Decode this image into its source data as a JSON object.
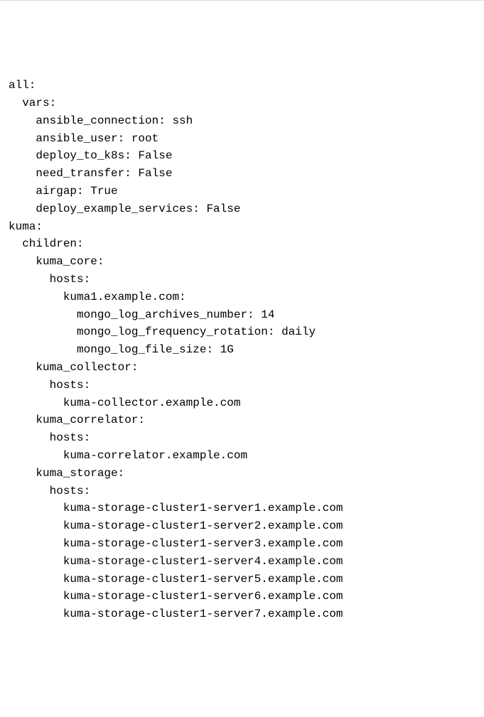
{
  "lines": [
    {
      "indent": 0,
      "text": "all:"
    },
    {
      "indent": 1,
      "text": "vars:"
    },
    {
      "indent": 2,
      "text": "ansible_connection: ssh"
    },
    {
      "indent": 2,
      "text": "ansible_user: root"
    },
    {
      "indent": 2,
      "text": "deploy_to_k8s: False"
    },
    {
      "indent": 2,
      "text": "need_transfer: False"
    },
    {
      "indent": 2,
      "text": "airgap: True"
    },
    {
      "indent": 2,
      "text": "deploy_example_services: False"
    },
    {
      "indent": 0,
      "text": "kuma:"
    },
    {
      "indent": 1,
      "text": "children:"
    },
    {
      "indent": 2,
      "text": "kuma_core:"
    },
    {
      "indent": 3,
      "text": "hosts:"
    },
    {
      "indent": 4,
      "text": "kuma1.example.com:"
    },
    {
      "indent": 5,
      "text": "mongo_log_archives_number: 14"
    },
    {
      "indent": 5,
      "text": "mongo_log_frequency_rotation: daily"
    },
    {
      "indent": 5,
      "text": "mongo_log_file_size: 1G"
    },
    {
      "indent": 2,
      "text": "kuma_collector:"
    },
    {
      "indent": 3,
      "text": "hosts:"
    },
    {
      "indent": 4,
      "text": "kuma-collector.example.com"
    },
    {
      "indent": 2,
      "text": "kuma_correlator:"
    },
    {
      "indent": 3,
      "text": "hosts:"
    },
    {
      "indent": 4,
      "text": "kuma-correlator.example.com"
    },
    {
      "indent": 2,
      "text": "kuma_storage:"
    },
    {
      "indent": 3,
      "text": "hosts:"
    },
    {
      "indent": 4,
      "text": "kuma-storage-cluster1-server1.example.com"
    },
    {
      "indent": 4,
      "text": "kuma-storage-cluster1-server2.example.com"
    },
    {
      "indent": 4,
      "text": "kuma-storage-cluster1-server3.example.com"
    },
    {
      "indent": 4,
      "text": "kuma-storage-cluster1-server4.example.com"
    },
    {
      "indent": 4,
      "text": "kuma-storage-cluster1-server5.example.com"
    },
    {
      "indent": 4,
      "text": "kuma-storage-cluster1-server6.example.com"
    },
    {
      "indent": 4,
      "text": "kuma-storage-cluster1-server7.example.com"
    }
  ],
  "indent_unit": "  "
}
